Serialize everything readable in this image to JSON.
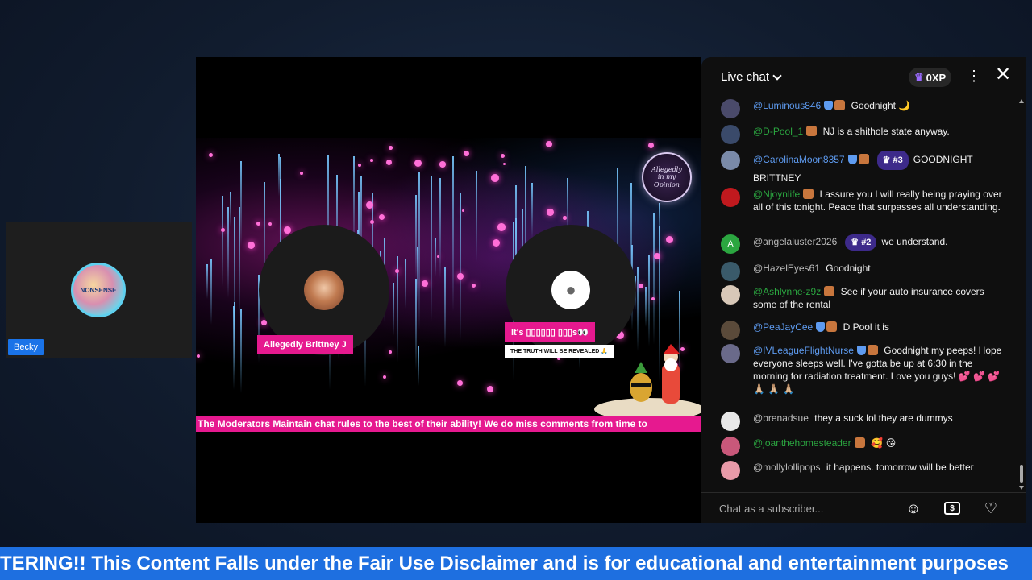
{
  "guest": {
    "name": "Becky",
    "avatar_text": "NONSENSE"
  },
  "stage": {
    "host1_label": "Allegedly Brittney J",
    "host2_label": "It's ▯▯▯▯▯▯ ▯▯▯s👀",
    "host2_sublabel": "THE TRUTH WILL BE REVEALED 🙏",
    "brand_badge": "Allegedly in my Opinion",
    "pink_ticker": "The Moderators Maintain chat rules to the best of their ability! We do miss comments from time to"
  },
  "chat": {
    "title": "Live chat",
    "xp": "0XP",
    "input_placeholder": "Chat as a subscriber...",
    "messages": [
      {
        "author": "@Luminous846",
        "text": "Goodnight 🌙",
        "color": "#5e9bf0",
        "avatar_bg": "#4a4a6a"
      },
      {
        "author": "@D-Pool_1",
        "text": "NJ is a shithole state anyway.",
        "color": "#2ba640",
        "avatar_bg": "#3a4a6a"
      },
      {
        "author": "@CarolinaMoon8357",
        "rank": "#3",
        "text": "GOODNIGHT BRITTNEY",
        "color": "#5e9bf0",
        "avatar_bg": "#7a8aa8"
      },
      {
        "author": "@Njoynlife",
        "text": "I assure you I will really being praying over all of this tonight. Peace that surpasses all understanding.",
        "color": "#2ba640",
        "avatar_bg": "#c0191e"
      },
      {
        "author": "@angelaluster2026",
        "rank": "#2",
        "text": "we understand.",
        "color": "#bbbbbb",
        "avatar_bg": "#2ba640",
        "avatar_letter": "A"
      },
      {
        "author": "@HazelEyes61",
        "text": "Goodnight",
        "color": "#bbbbbb",
        "avatar_bg": "#3a5a6a"
      },
      {
        "author": "@Ashlynne-z9z",
        "text": "See if your auto insurance covers some of the rental",
        "color": "#2ba640",
        "avatar_bg": "#d8c8b8"
      },
      {
        "author": "@PeaJayCee",
        "text": "D Pool it is",
        "color": "#5e9bf0",
        "avatar_bg": "#5a4a3a"
      },
      {
        "author": "@IVLeagueFlightNurse",
        "text": "Goodnight my peeps! Hope everyone sleeps well. I've gotta be up at 6:30 in the morning for radiation treatment. Love you guys! 💕 💕 💕 🙏🏼 🙏🏼 🙏🏼",
        "color": "#5e9bf0",
        "avatar_bg": "#6a6a8a"
      },
      {
        "author": "@brenadsue",
        "text": "they a suck lol they are dummys",
        "color": "#bbbbbb",
        "avatar_bg": "#e8e8e8"
      },
      {
        "author": "@joanthehomesteader",
        "text": "🥰 😘",
        "color": "#2ba640",
        "avatar_bg": "#c8587a"
      },
      {
        "author": "@mollylollipops",
        "text": "it happens. tomorrow will be better",
        "color": "#bbbbbb",
        "avatar_bg": "#e89aa8"
      }
    ]
  },
  "bottom_ticker": "TERING!! This Content Falls under the Fair Use Disclaimer and is for educational and entertainment purposes"
}
